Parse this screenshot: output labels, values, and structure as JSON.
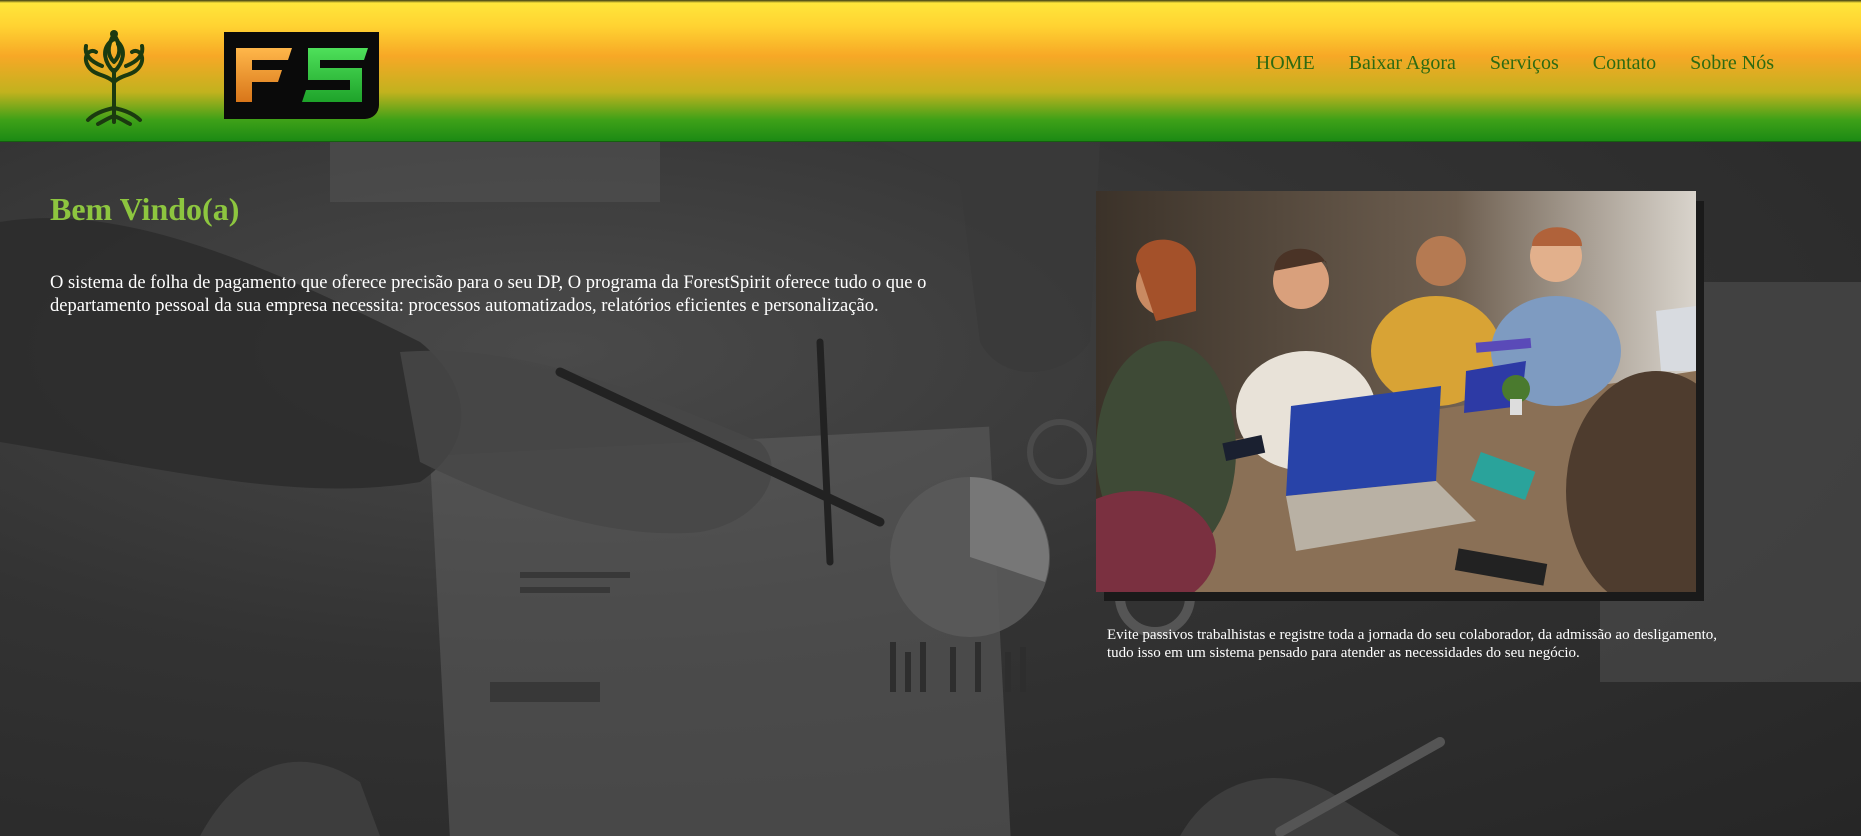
{
  "header": {
    "tree_logo_icon": "tree-of-life-icon",
    "brand_logo_text": "FS",
    "nav": [
      {
        "label": "HOME"
      },
      {
        "label": "Baixar Agora"
      },
      {
        "label": "Serviços"
      },
      {
        "label": "Contato"
      },
      {
        "label": "Sobre Nós"
      }
    ]
  },
  "main": {
    "title": "Bem Vindo(a)",
    "intro": "O sistema de folha de pagamento que oferece precisão para o seu DP, O programa da ForestSpirit oferece tudo o que o departamento pessoal da sua empresa necessita: processos automatizados, relatórios eficientes e personalização.",
    "photo_alt": "team-meeting-photo",
    "caption": "Evite passivos trabalhistas e registre toda a jornada do seu colaborador, da admissão ao desligamento, tudo isso em um sistema pensado para atender as necessidades do seu negócio."
  },
  "colors": {
    "accent_green": "#8dc63f",
    "nav_text": "#2d6a12",
    "header_top": "#ffe63a",
    "header_bottom": "#1c8a14",
    "logo_orange": "#f39a1e",
    "logo_green": "#2ecc3a"
  }
}
